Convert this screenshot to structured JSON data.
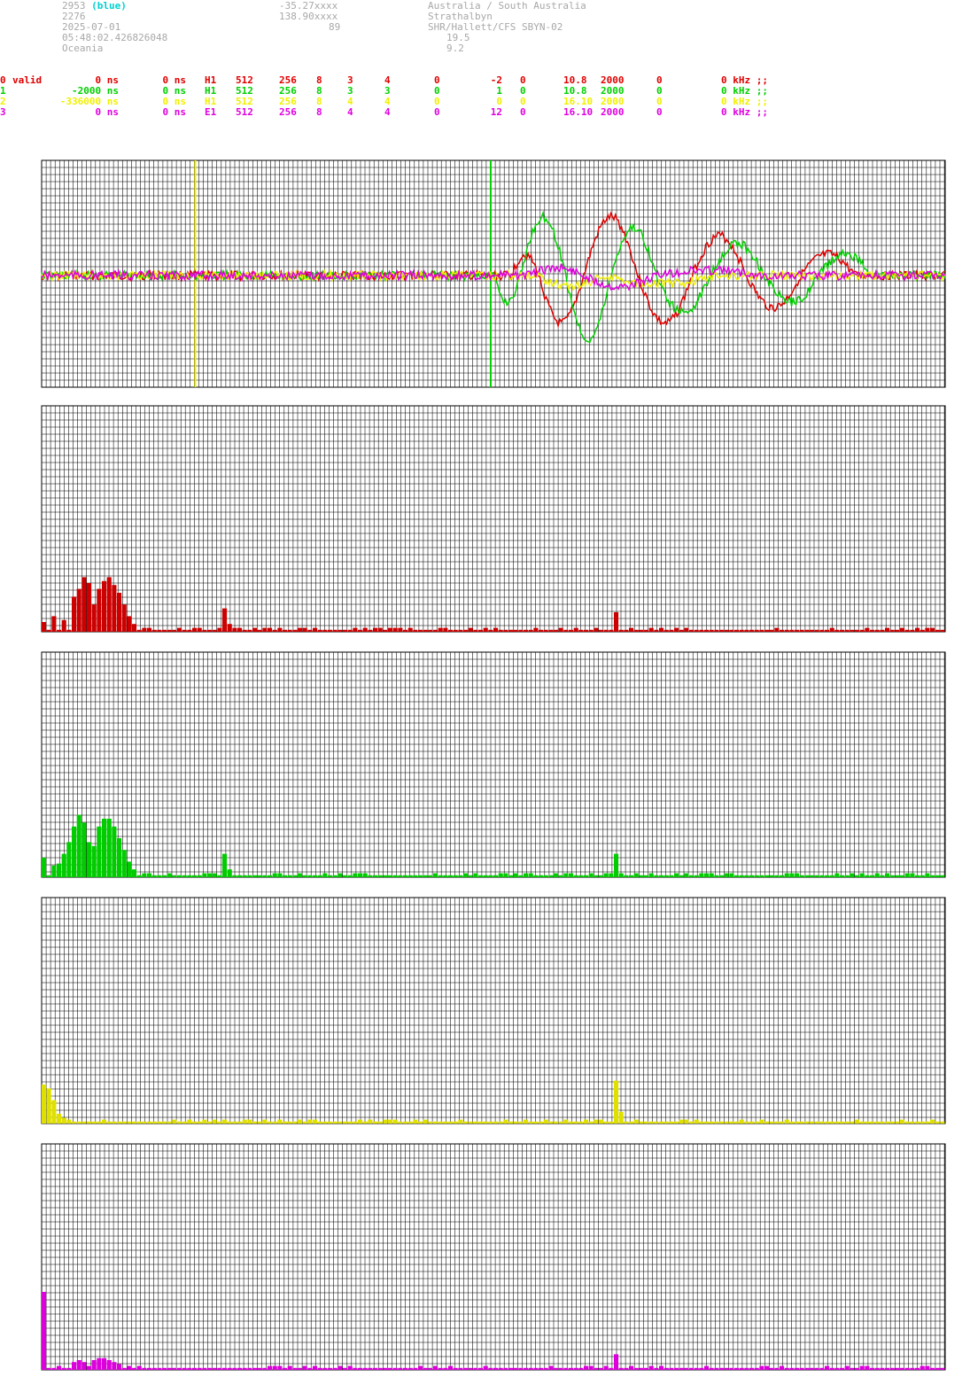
{
  "header": {
    "station_id": "2953",
    "station_tag": "(blue)",
    "station_number": "2276",
    "date": "2025-07-01",
    "time": "05:48:02.426826048",
    "region": "Oceania",
    "lat": "-35.27xxxx",
    "lon": "138.90xxxx",
    "alt": "89",
    "location": "Australia / South Australia",
    "place": "Strathalbyn",
    "site": "SHR/Hallett/CFS SBYN-02",
    "val1": "19.5",
    "val2": "9.2"
  },
  "channels": [
    {
      "id": "0",
      "status": "valid",
      "offset": "0 ns",
      "offset2": "0 ns",
      "type": "H1",
      "n1": "512",
      "n2": "256",
      "n3": "8",
      "n4": "3",
      "n5": "4",
      "n6": "0",
      "n7": "-2",
      "n8": "0",
      "freq": "10.8",
      "rate": "2000",
      "n9": "0",
      "khz": "0 kHz ;;"
    },
    {
      "id": "1",
      "status": "",
      "offset": "-2000 ns",
      "offset2": "0 ns",
      "type": "H1",
      "n1": "512",
      "n2": "256",
      "n3": "8",
      "n4": "3",
      "n5": "3",
      "n6": "0",
      "n7": "1",
      "n8": "0",
      "freq": "10.8",
      "rate": "2000",
      "n9": "0",
      "khz": "0 kHz ;;"
    },
    {
      "id": "2",
      "status": "",
      "offset": "-336000 ns",
      "offset2": "0 ns",
      "type": "H1",
      "n1": "512",
      "n2": "256",
      "n3": "8",
      "n4": "4",
      "n5": "4",
      "n6": "0",
      "n7": "0",
      "n8": "0",
      "freq": "16.10",
      "rate": "2000",
      "n9": "0",
      "khz": "0 kHz ;;"
    },
    {
      "id": "3",
      "status": "",
      "offset": "0 ns",
      "offset2": "0 ns",
      "type": "E1",
      "n1": "512",
      "n2": "256",
      "n3": "8",
      "n4": "4",
      "n5": "4",
      "n6": "0",
      "n7": "12",
      "n8": "0",
      "freq": "16.10",
      "rate": "2000",
      "n9": "0",
      "khz": "0 kHz ;;"
    }
  ],
  "colors": {
    "ch0": "#e00000",
    "ch1": "#00d000",
    "ch2": "#f0f000",
    "ch3": "#e000e0",
    "grid": "#000000"
  },
  "chart_data": [
    {
      "type": "line",
      "title": "",
      "grid": true,
      "series": [
        {
          "color": "#e00000",
          "burst": [
            [
              0.52,
              0.55,
              -8,
              5
            ],
            [
              0.55,
              0.6,
              18,
              4
            ],
            [
              0.6,
              0.66,
              -22,
              5
            ],
            [
              0.66,
              0.72,
              18,
              4
            ],
            [
              0.72,
              0.78,
              -15,
              4
            ],
            [
              0.78,
              0.84,
              12,
              4
            ],
            [
              0.84,
              0.9,
              -8,
              4
            ]
          ]
        },
        {
          "color": "#00d000",
          "burst": [
            [
              0.5,
              0.53,
              10,
              5
            ],
            [
              0.53,
              0.58,
              -22,
              4
            ],
            [
              0.58,
              0.63,
              24,
              4
            ],
            [
              0.63,
              0.68,
              -18,
              4
            ],
            [
              0.68,
              0.74,
              14,
              4
            ],
            [
              0.74,
              0.8,
              -12,
              4
            ],
            [
              0.8,
              0.86,
              10,
              4
            ],
            [
              0.86,
              0.92,
              -8,
              4
            ]
          ]
        },
        {
          "color": "#f0f000",
          "burst": [
            [
              0.55,
              0.62,
              4,
              4
            ],
            [
              0.62,
              0.75,
              3,
              4
            ]
          ]
        },
        {
          "color": "#e000e0",
          "burst": [
            [
              0.54,
              0.6,
              -3,
              5
            ],
            [
              0.6,
              0.68,
              4,
              4
            ],
            [
              0.68,
              0.8,
              -2,
              4
            ]
          ]
        }
      ],
      "markers": [
        {
          "x": 0.17,
          "color": "#f0f000"
        },
        {
          "x": 0.497,
          "color": "#00d000"
        }
      ]
    },
    {
      "type": "bar",
      "color": "#cc0000",
      "bins": 180,
      "peaks": [
        [
          0,
          5
        ],
        [
          2,
          8
        ],
        [
          4,
          6
        ],
        [
          6,
          18
        ],
        [
          7,
          22
        ],
        [
          8,
          28
        ],
        [
          9,
          25
        ],
        [
          10,
          14
        ],
        [
          11,
          22
        ],
        [
          12,
          26
        ],
        [
          13,
          28
        ],
        [
          14,
          24
        ],
        [
          15,
          20
        ],
        [
          16,
          14
        ],
        [
          17,
          8
        ],
        [
          18,
          4
        ],
        [
          20,
          2
        ],
        [
          36,
          12
        ],
        [
          37,
          4
        ],
        [
          114,
          10
        ]
      ],
      "floor": 1
    },
    {
      "type": "bar",
      "color": "#00cc00",
      "bins": 180,
      "peaks": [
        [
          0,
          10
        ],
        [
          2,
          6
        ],
        [
          3,
          7
        ],
        [
          4,
          12
        ],
        [
          5,
          18
        ],
        [
          6,
          26
        ],
        [
          7,
          32
        ],
        [
          8,
          28
        ],
        [
          9,
          18
        ],
        [
          10,
          16
        ],
        [
          11,
          26
        ],
        [
          12,
          30
        ],
        [
          13,
          30
        ],
        [
          14,
          26
        ],
        [
          15,
          20
        ],
        [
          16,
          14
        ],
        [
          17,
          8
        ],
        [
          18,
          4
        ],
        [
          20,
          2
        ],
        [
          36,
          12
        ],
        [
          37,
          4
        ],
        [
          114,
          12
        ]
      ],
      "floor": 1
    },
    {
      "type": "bar",
      "color": "#e0e000",
      "bins": 180,
      "peaks": [
        [
          0,
          20
        ],
        [
          1,
          18
        ],
        [
          2,
          12
        ],
        [
          3,
          5
        ],
        [
          4,
          3
        ],
        [
          114,
          22
        ],
        [
          115,
          6
        ]
      ],
      "floor": 1
    },
    {
      "type": "bar",
      "color": "#dd00dd",
      "bins": 180,
      "peaks": [
        [
          0,
          40
        ],
        [
          6,
          4
        ],
        [
          7,
          5
        ],
        [
          8,
          4
        ],
        [
          10,
          5
        ],
        [
          11,
          6
        ],
        [
          12,
          6
        ],
        [
          13,
          5
        ],
        [
          14,
          4
        ],
        [
          15,
          3
        ],
        [
          114,
          8
        ]
      ],
      "floor": 1
    }
  ]
}
